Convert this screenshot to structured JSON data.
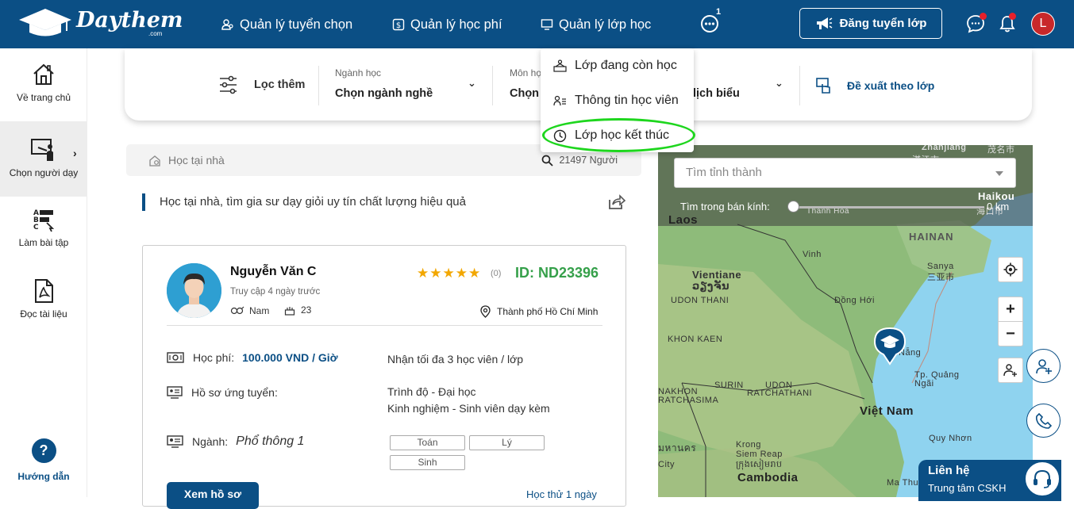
{
  "brand": {
    "name": "Daythem",
    "sub": ".com"
  },
  "nav": {
    "recruit": "Quản lý tuyển chọn",
    "tuition": "Quản lý học phí",
    "classes": "Quản lý lớp học",
    "more_badge": "1",
    "post_button": "Đăng tuyển lớp",
    "avatar_letter": "L"
  },
  "sidebar": {
    "home": "Về trang chủ",
    "choose_tutor": "Chọn người dạy",
    "homework": "Làm bài tập",
    "documents": "Đọc tài liệu",
    "help_mark": "?",
    "help": "Hướng dẫn"
  },
  "filter": {
    "more": "Lọc thêm",
    "major_label": "Ngành học",
    "major_value": "Chọn ngành nghề",
    "subject_label": "Môn học",
    "subject_value": "Chọn",
    "schedule_value": "lịch biểu",
    "suggest": "Đề xuất theo lớp"
  },
  "dropdown": {
    "active": "Lớp đang còn học",
    "students": "Thông tin học viên",
    "ended": "Lớp học kết thúc"
  },
  "search": {
    "location": "Học tại nhà",
    "count": "21497 Người"
  },
  "headline": "Học tại nhà, tìm gia sư dạy giỏi uy tín chất lượng hiệu quả",
  "tutor": {
    "name": "Nguyễn Văn C",
    "last_seen": "Truy cập 4 ngày trước",
    "sex": "Nam",
    "age": "23",
    "rating": 5,
    "stars": "★★★★★",
    "rating_count": "(0)",
    "id": "ID: ND23396",
    "city": "Thành phố Hồ Chí Minh",
    "fee_label": "Học phí:",
    "fee_value": "100.000 VND / Giờ",
    "capacity": "Nhận tối đa 3 học viên / lớp",
    "profile_label": "Hồ sơ ứng tuyển:",
    "level": "Trình độ - Đại học",
    "experience": "Kinh nghiệm - Sinh viên dạy kèm",
    "major_label": "Ngành:",
    "major_value": "Phổ thông 1",
    "subjects": [
      "Toán",
      "Lý",
      "Sinh"
    ],
    "view_button": "Xem hồ sơ",
    "trial": "Học thử 1 ngày"
  },
  "map": {
    "province_placeholder": "Tìm tỉnh thành",
    "radius_label": "Tìm trong bán kính:",
    "radius_value": "0 km",
    "labels": {
      "zhanjiang": "Zhanjiang",
      "zhanjiang_cn": "湛江市",
      "haikou": "Haikou",
      "haikou_cn": "海口市",
      "thanh_hoa": "Thanh Hóa",
      "laos": "Laos",
      "hainan": "HAINAN",
      "vinh": "Vinh",
      "sanya": "Sanya",
      "sanya_cn": "三亚市",
      "vientiane": "Vientiane",
      "vientiane_th": "ວຽງຈັນ",
      "udon": "UDON THANI",
      "dong_hoi": "Đồng Hới",
      "khon_kaen": "KHON KAEN",
      "da_nang": "Nẵng",
      "tam_ky": "Tp. Quảng",
      "tam_ky2": "Ngãi",
      "surin": "SURIN",
      "udon_r": "UDON",
      "ratchathani": "RATCHATHANI",
      "nakhon": "NAKHON",
      "rachasima": "RATCHASIMA",
      "vietnam": "Việt Nam",
      "quy_nhon": "Quy Nhơn",
      "krong": "Krong",
      "siem_reap": "Siem Reap",
      "siem_kh": "ក្រុងសៀមរាប",
      "thai": "มหานคร",
      "city": "City",
      "cambodia": "Cambodia",
      "ma_thuot": "Ma Thuột",
      "lao_cn": "茂名市"
    }
  },
  "contact": {
    "title": "Liên hệ",
    "subtitle": "Trung tâm CSKH"
  }
}
